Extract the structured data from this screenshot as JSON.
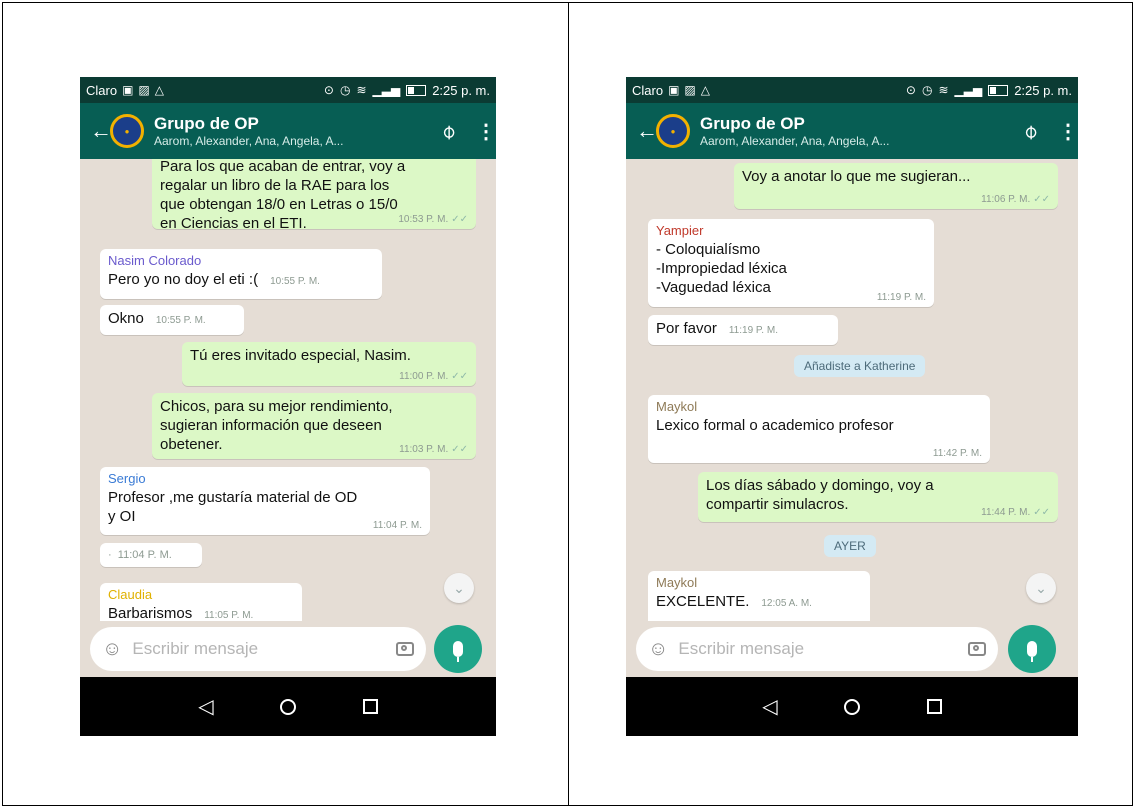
{
  "screens": [
    {
      "status": {
        "carrier": "Claro",
        "time": "2:25 p. m."
      },
      "header": {
        "title": "Grupo de OP",
        "members": "Aarom, Alexander, Ana, Angela, A..."
      },
      "messages": [
        {
          "text": "Para los que acaban de entrar, voy a\nregalar un libro de la RAE para los\nque obtengan 18/0 en Letras o 15/0\nen Ciencias en el ETI.",
          "time": "10:53 P. M."
        },
        {
          "sender": "Nasim Colorado",
          "text": "Pero yo no doy el eti :(",
          "time": "10:55 P. M."
        },
        {
          "text": "Okno",
          "time": "10:55 P. M."
        },
        {
          "text": "Tú eres invitado especial, Nasim.",
          "time": "11:00 P. M."
        },
        {
          "text": "Chicos, para su mejor rendimiento,\nsugieran información que deseen\nobetener.",
          "time": "11:03 P. M."
        },
        {
          "sender": "Sergio",
          "text": "Profesor ,me gustaría material de OD\ny OI",
          "time": "11:04 P. M."
        },
        {
          "text": "·",
          "time": "11:04 P. M."
        },
        {
          "sender": "Claudia",
          "text": "Barbarismos",
          "time": "11:05 P. M."
        }
      ],
      "input_placeholder": "Escribir mensaje"
    },
    {
      "status": {
        "carrier": "Claro",
        "time": "2:25 p. m."
      },
      "header": {
        "title": "Grupo de OP",
        "members": "Aarom, Alexander, Ana, Angela, A..."
      },
      "messages": [
        {
          "text": "Voy a anotar lo que me sugieran...",
          "time": "11:06 P. M."
        },
        {
          "sender": "Yampier",
          "text": "- Coloquialísmo\n-Impropiedad léxica\n-Vaguedad léxica",
          "time": "11:19 P. M."
        },
        {
          "text": "Por favor",
          "time": "11:19 P. M."
        },
        {
          "system": "Añadiste a Katherine"
        },
        {
          "sender": "Maykol",
          "text": "Lexico formal o academico profesor",
          "time": "11:42 P. M."
        },
        {
          "text": "Los días sábado y domingo, voy a\ncompartir simulacros.",
          "time": "11:44 P. M."
        },
        {
          "system": "AYER"
        },
        {
          "sender": "Maykol",
          "text": "EXCELENTE.",
          "time": "12:05 A. M."
        }
      ],
      "input_placeholder": "Escribir mensaje"
    }
  ],
  "colors": {
    "header": "#075e54",
    "statusbar": "#0b3b33",
    "outgoing_bubble": "#dcf8c6",
    "incoming_bubble": "#ffffff",
    "chat_background": "#e5ddd5",
    "mic_button": "#1fa58a",
    "sender_nasim": "#6a5acd",
    "sender_sergio": "#3a7bd5",
    "sender_claudia": "#e0b100",
    "sender_yampier": "#c0392b",
    "sender_maykol": "#8e7a57"
  },
  "icons": [
    "back-arrow-icon",
    "group-avatar-icon",
    "attach-icon",
    "menu-icon",
    "emoji-icon",
    "camera-icon",
    "mic-icon",
    "scroll-down-icon",
    "nav-back-icon",
    "nav-home-icon",
    "nav-recents-icon"
  ]
}
